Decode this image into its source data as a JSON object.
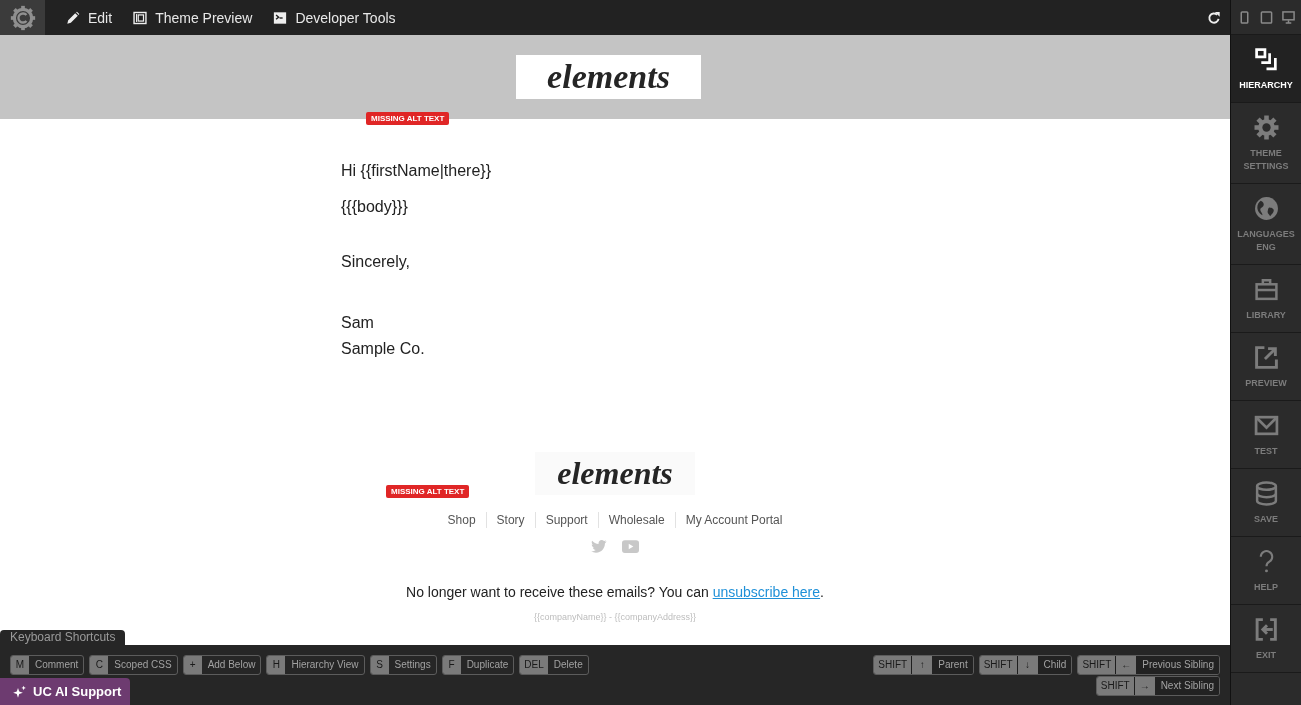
{
  "top_bar": {
    "menu": [
      {
        "label": "Edit"
      },
      {
        "label": "Theme Preview"
      },
      {
        "label": "Developer Tools"
      }
    ]
  },
  "sidebar": {
    "items": [
      {
        "label": "HIERARCHY",
        "selected": true
      },
      {
        "label": "THEME SETTINGS",
        "selected": false
      },
      {
        "label": "LANGUAGES ENG",
        "selected": false
      },
      {
        "label": "LIBRARY",
        "selected": false
      },
      {
        "label": "PREVIEW",
        "selected": false
      },
      {
        "label": "TEST",
        "selected": false
      },
      {
        "label": "SAVE",
        "selected": false
      },
      {
        "label": "HELP",
        "selected": false
      },
      {
        "label": "EXIT",
        "selected": false
      }
    ]
  },
  "email": {
    "header": {
      "logo_text": "elements",
      "alert": "MISSING ALT TEXT"
    },
    "greeting": "Hi {{firstName|there}}",
    "body": "{{{body}}}",
    "closing": "Sincerely,",
    "signature": [
      "Sam",
      "Sample Co."
    ],
    "footer": {
      "logo_text": "elements",
      "alert": "MISSING ALT TEXT",
      "links": [
        "Shop",
        "Story",
        "Support",
        "Wholesale",
        "My Account Portal"
      ],
      "unsubscribe": {
        "text": "No longer want to receive these emails? You can ",
        "link": "unsubscribe here",
        "after": "."
      },
      "company_line": "{{companyName}} - {{companyAddress}}"
    }
  },
  "shortcuts": {
    "title": "Keyboard Shortcuts",
    "left": [
      {
        "key": "M",
        "label": "Comment"
      },
      {
        "key": "C",
        "label": "Scoped CSS"
      },
      {
        "key": "+",
        "label": "Add Below"
      },
      {
        "key": "H",
        "label": "Hierarchy View"
      },
      {
        "key": "S",
        "label": "Settings"
      },
      {
        "key": "F",
        "label": "Duplicate"
      },
      {
        "key": "DEL",
        "label": "Delete"
      }
    ],
    "right": [
      {
        "key": "SHIFT",
        "arrow": "↑",
        "label": "Parent"
      },
      {
        "key": "SHIFT",
        "arrow": "↓",
        "label": "Child"
      },
      {
        "key": "SHIFT",
        "arrow": "←",
        "label": "Previous Sibling"
      },
      {
        "key": "SHIFT",
        "arrow": "→",
        "label": "Next Sibling"
      }
    ]
  },
  "ai_support": {
    "label": "UC AI Support"
  }
}
